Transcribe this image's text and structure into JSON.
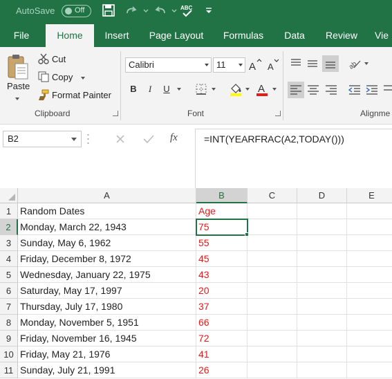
{
  "titlebar": {
    "autosave_label": "AutoSave",
    "autosave_state": "Off"
  },
  "tabs": [
    "File",
    "Home",
    "Insert",
    "Page Layout",
    "Formulas",
    "Data",
    "Review",
    "Vie"
  ],
  "ribbon": {
    "clipboard": {
      "paste": "Paste",
      "cut": "Cut",
      "copy": "Copy",
      "format_painter": "Format Painter",
      "label": "Clipboard"
    },
    "font": {
      "family": "Calibri",
      "size": "11",
      "bold": "B",
      "italic": "I",
      "underline": "U",
      "label": "Font"
    },
    "alignment": {
      "label": "Alignme"
    }
  },
  "formula_bar": {
    "name_box": "B2",
    "fx": "fx",
    "formula": "=INT(YEARFRAC(A2,TODAY()))"
  },
  "sheet": {
    "columns": [
      "A",
      "B",
      "C",
      "D",
      "E"
    ],
    "rows": [
      {
        "num": "1",
        "a": "Random Dates",
        "b": "Age"
      },
      {
        "num": "2",
        "a": "Monday, March 22, 1943",
        "b": "75"
      },
      {
        "num": "3",
        "a": "Sunday, May 6, 1962",
        "b": "55"
      },
      {
        "num": "4",
        "a": "Friday, December 8, 1972",
        "b": "45"
      },
      {
        "num": "5",
        "a": "Wednesday, January 22, 1975",
        "b": "43"
      },
      {
        "num": "6",
        "a": "Saturday, May 17, 1997",
        "b": "20"
      },
      {
        "num": "7",
        "a": "Thursday, July 17, 1980",
        "b": "37"
      },
      {
        "num": "8",
        "a": "Monday, November 5, 1951",
        "b": "66"
      },
      {
        "num": "9",
        "a": "Friday, November 16, 1945",
        "b": "72"
      },
      {
        "num": "10",
        "a": "Friday, May 21, 1976",
        "b": "41"
      },
      {
        "num": "11",
        "a": "Sunday, July 21, 1991",
        "b": "26"
      }
    ]
  },
  "colors": {
    "excel_green": "#217346",
    "age_red": "#e31b1b"
  }
}
